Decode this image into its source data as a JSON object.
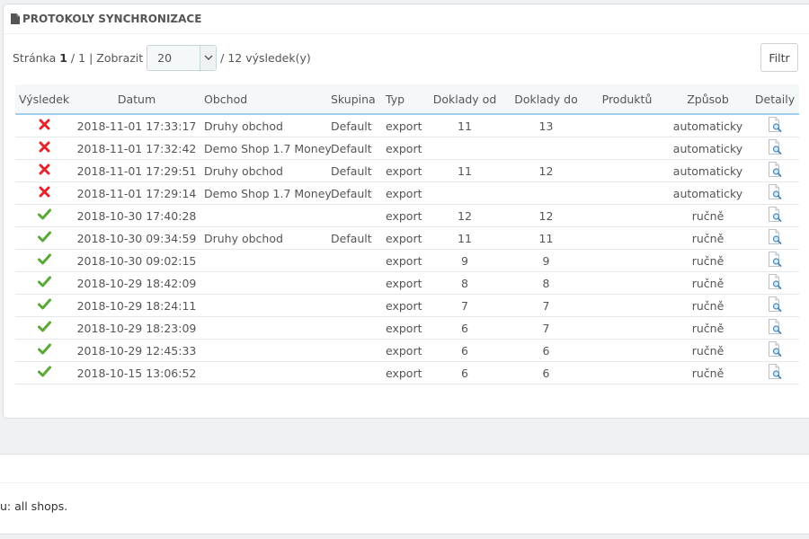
{
  "panel": {
    "title": "PROTOKOLY SYNCHRONIZACE",
    "title_icon": "document-icon"
  },
  "pagination": {
    "page_label": "Stránka",
    "current_page": "1",
    "total_pages": "/ 1",
    "separator": "|",
    "show_label": "Zobrazit",
    "per_page": "20",
    "results_text": "/ 12 výsledek(y)"
  },
  "filter_button": {
    "label": "Filtr"
  },
  "table": {
    "headers": {
      "result": "Výsledek",
      "date": "Datum",
      "shop": "Obchod",
      "group": "Skupina",
      "type": "Typ",
      "doc_from": "Doklady od",
      "doc_to": "Doklady do",
      "products": "Produktů",
      "method": "Způsob",
      "details": "Detaily"
    },
    "rows": [
      {
        "status": "error",
        "date": "2018-11-01 17:33:17",
        "shop": "Druhy obchod",
        "group": "Default",
        "type": "export",
        "doc_from": "11",
        "doc_to": "13",
        "products": "",
        "method": "automaticky"
      },
      {
        "status": "error",
        "date": "2018-11-01 17:32:42",
        "shop": "Demo Shop 1.7 Money",
        "group": "Default",
        "type": "export",
        "doc_from": "",
        "doc_to": "",
        "products": "",
        "method": "automaticky"
      },
      {
        "status": "error",
        "date": "2018-11-01 17:29:51",
        "shop": "Druhy obchod",
        "group": "Default",
        "type": "export",
        "doc_from": "11",
        "doc_to": "12",
        "products": "",
        "method": "automaticky"
      },
      {
        "status": "error",
        "date": "2018-11-01 17:29:14",
        "shop": "Demo Shop 1.7 Money",
        "group": "Default",
        "type": "export",
        "doc_from": "",
        "doc_to": "",
        "products": "",
        "method": "automaticky"
      },
      {
        "status": "ok",
        "date": "2018-10-30 17:40:28",
        "shop": "",
        "group": "",
        "type": "export",
        "doc_from": "12",
        "doc_to": "12",
        "products": "",
        "method": "ručně"
      },
      {
        "status": "ok",
        "date": "2018-10-30 09:34:59",
        "shop": "Druhy obchod",
        "group": "Default",
        "type": "export",
        "doc_from": "11",
        "doc_to": "11",
        "products": "",
        "method": "ručně"
      },
      {
        "status": "ok",
        "date": "2018-10-30 09:02:15",
        "shop": "",
        "group": "",
        "type": "export",
        "doc_from": "9",
        "doc_to": "9",
        "products": "",
        "method": "ručně"
      },
      {
        "status": "ok",
        "date": "2018-10-29 18:42:09",
        "shop": "",
        "group": "",
        "type": "export",
        "doc_from": "8",
        "doc_to": "8",
        "products": "",
        "method": "ručně"
      },
      {
        "status": "ok",
        "date": "2018-10-29 18:24:11",
        "shop": "",
        "group": "",
        "type": "export",
        "doc_from": "7",
        "doc_to": "7",
        "products": "",
        "method": "ručně"
      },
      {
        "status": "ok",
        "date": "2018-10-29 18:23:09",
        "shop": "",
        "group": "",
        "type": "export",
        "doc_from": "6",
        "doc_to": "7",
        "products": "",
        "method": "ručně"
      },
      {
        "status": "ok",
        "date": "2018-10-29 12:45:33",
        "shop": "",
        "group": "",
        "type": "export",
        "doc_from": "6",
        "doc_to": "6",
        "products": "",
        "method": "ručně"
      },
      {
        "status": "ok",
        "date": "2018-10-15 13:06:52",
        "shop": "",
        "group": "",
        "type": "export",
        "doc_from": "6",
        "doc_to": "6",
        "products": "",
        "method": "ručně"
      }
    ]
  },
  "footer": {
    "text": "u: all shops."
  },
  "colors": {
    "error": "#e0262b",
    "ok": "#59a838",
    "header_border": "#a0d0eb"
  }
}
